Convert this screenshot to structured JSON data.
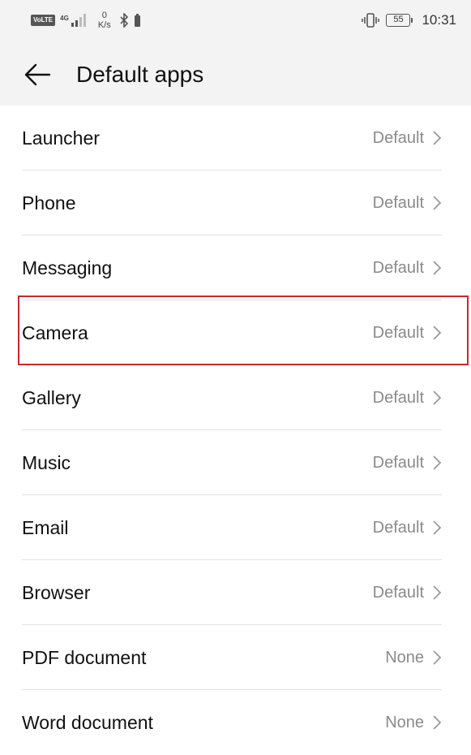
{
  "status_bar": {
    "volte": "VoLTE",
    "network_type": "4G",
    "speed_value": "0",
    "speed_unit": "K/s",
    "battery": "55",
    "time": "10:31",
    "icons": [
      "signal-icon",
      "bluetooth-icon",
      "battery-saver-icon",
      "vibrate-icon",
      "battery-icon"
    ]
  },
  "header": {
    "title": "Default apps"
  },
  "apps": [
    {
      "label": "Launcher",
      "value": "Default"
    },
    {
      "label": "Phone",
      "value": "Default"
    },
    {
      "label": "Messaging",
      "value": "Default"
    },
    {
      "label": "Camera",
      "value": "Default"
    },
    {
      "label": "Gallery",
      "value": "Default"
    },
    {
      "label": "Music",
      "value": "Default"
    },
    {
      "label": "Email",
      "value": "Default"
    },
    {
      "label": "Browser",
      "value": "Default"
    },
    {
      "label": "PDF document",
      "value": "None"
    },
    {
      "label": "Word document",
      "value": "None"
    }
  ],
  "highlight_color": "#c8282f"
}
